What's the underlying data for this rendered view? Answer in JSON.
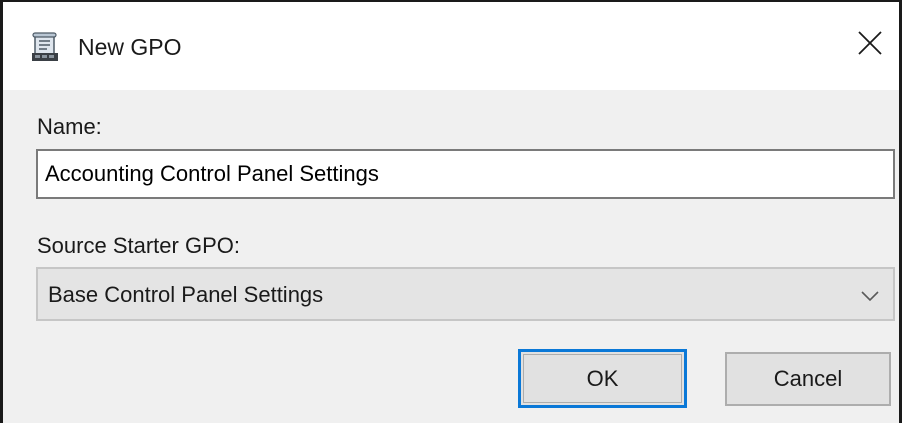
{
  "window": {
    "title": "New GPO",
    "title_icon": "gpo-scroll-icon",
    "close_icon": "close-icon"
  },
  "form": {
    "name_label": "Name:",
    "name_value": "Accounting Control Panel Settings",
    "source_label": "Source Starter GPO:",
    "source_selected": "Base Control Panel Settings",
    "dropdown_icon": "chevron-down-icon"
  },
  "buttons": {
    "ok_label": "OK",
    "cancel_label": "Cancel"
  },
  "colors": {
    "focus_accent": "#0a78d7",
    "dialog_background": "#f0f0f0",
    "titlebar_background": "#ffffff"
  }
}
